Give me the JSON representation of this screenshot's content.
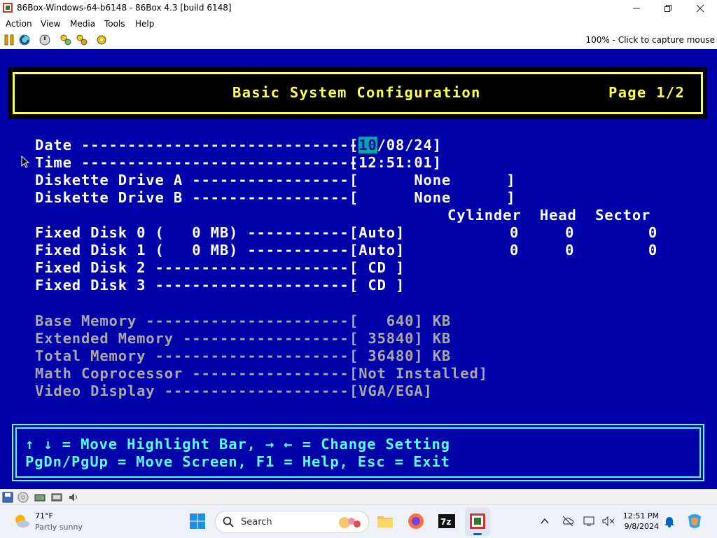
{
  "window": {
    "title": "86Box-Windows-64-b6148 - 86Box 4.3 [build 6148]"
  },
  "menu": [
    "Action",
    "View",
    "Media",
    "Tools",
    "Help"
  ],
  "toolbar": {
    "status_text": "100% - Click to capture mouse"
  },
  "bios": {
    "header_title": "Basic System Configuration",
    "header_page": "Page 1/2",
    "rows": {
      "date_label": "Date ------------------------------",
      "date_open": "[",
      "date_month": "10",
      "date_rest": "/08/24]",
      "time_label": "Time ------------------------------",
      "time_value": "[12:51:01]",
      "dda_label": "Diskette Drive A -----------------",
      "dda_value": "[      None      ]",
      "ddb_label": "Diskette Drive B -----------------",
      "ddb_value": "[      None      ]",
      "geom_header": "Cylinder  Head  Sector",
      "fd0_label": "Fixed Disk 0 (   0 MB) -----------",
      "fd0_value": "[Auto]",
      "fd0_geom": "0     0        0",
      "fd1_label": "Fixed Disk 1 (   0 MB) -----------",
      "fd1_value": "[Auto]",
      "fd1_geom": "0     0        0",
      "fd2_label": "Fixed Disk 2 ---------------------",
      "fd2_value": "[ CD ]",
      "fd3_label": "Fixed Disk 3 ---------------------",
      "fd3_value": "[ CD ]",
      "base_label": "Base Memory ----------------------",
      "base_value": "[   640] KB",
      "ext_label": "Extended Memory ------------------",
      "ext_value": "[ 35840] KB",
      "total_label": "Total Memory ---------------------",
      "total_value": "[ 36480] KB",
      "math_label": "Math Coprocessor -----------------",
      "math_value": "[Not Installed]",
      "video_label": "Video Display --------------------",
      "video_value": "[VGA/EGA]"
    },
    "footer": {
      "line1": "↑ ↓ = Move Highlight Bar, → ← = Change Setting",
      "line2": "PgDn/PgUp = Move Screen, F1 = Help, Esc = Exit"
    }
  },
  "taskbar": {
    "weather_temp": "71°F",
    "weather_desc": "Partly sunny",
    "search_placeholder": "Search",
    "time": "12:51 PM",
    "date": "9/8/2024"
  },
  "colors": {
    "bios_bg": "#0000a8",
    "bios_yellow": "#ffff54",
    "bios_cyan": "#54ffff",
    "bios_white": "#ffffff",
    "bios_gray": "#a8a8a8"
  }
}
